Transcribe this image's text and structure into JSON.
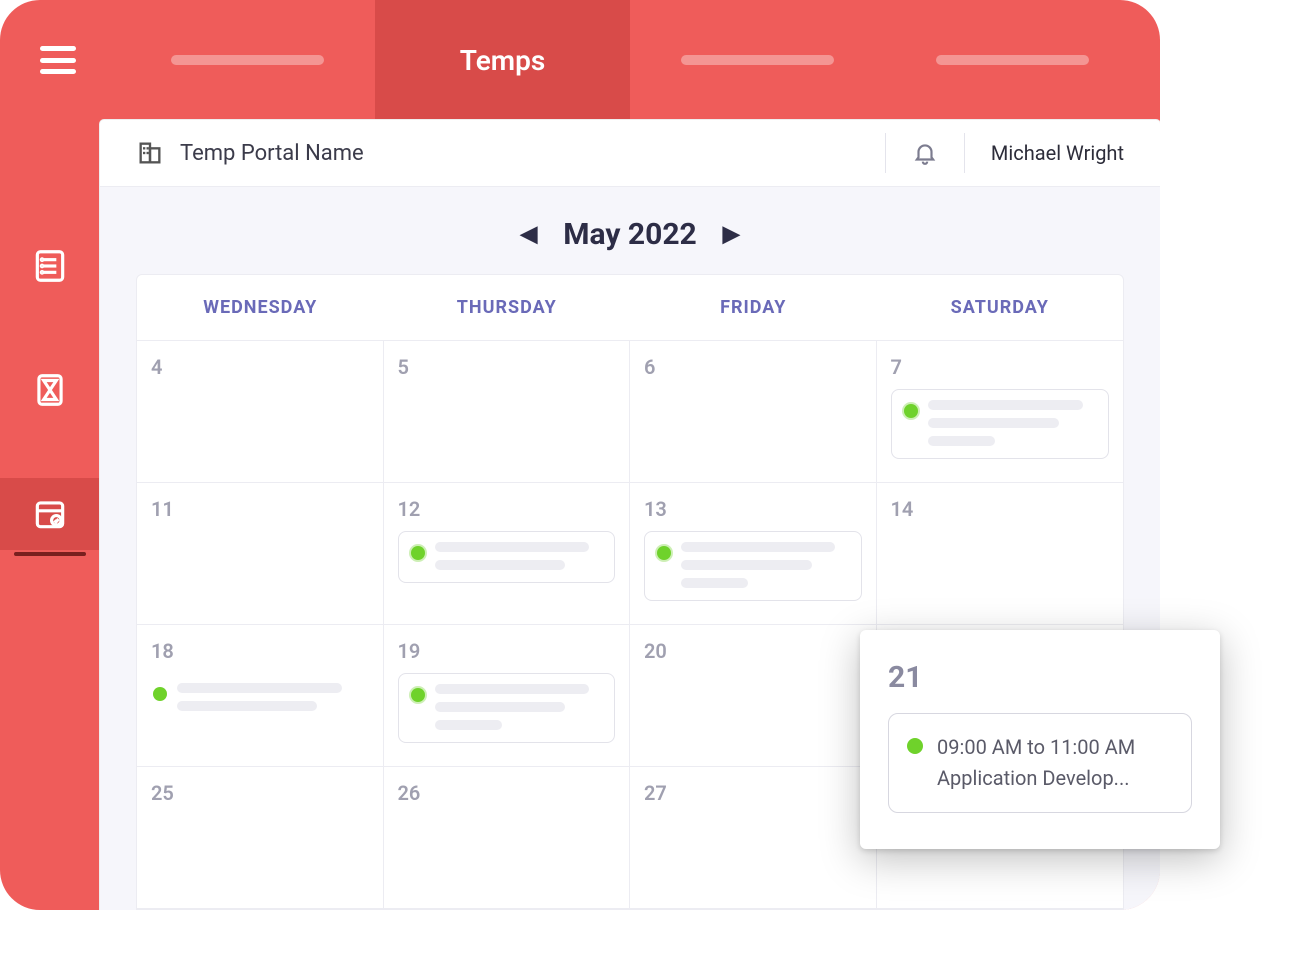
{
  "header": {
    "active_tab_label": "Temps"
  },
  "portal": {
    "name": "Temp Portal Name",
    "user": "Michael Wright"
  },
  "calendar": {
    "month_label": "May 2022",
    "days_of_week": [
      "WEDNESDAY",
      "THURSDAY",
      "FRIDAY",
      "SATURDAY"
    ],
    "weeks": [
      [
        {
          "n": "4"
        },
        {
          "n": "5"
        },
        {
          "n": "6"
        },
        {
          "n": "7",
          "event": {
            "lines": 3,
            "ring": true
          }
        }
      ],
      [
        {
          "n": "11"
        },
        {
          "n": "12",
          "event": {
            "lines": 2,
            "ring": true
          }
        },
        {
          "n": "13",
          "event": {
            "lines": 3,
            "ring": true
          }
        },
        {
          "n": "14"
        }
      ],
      [
        {
          "n": "18",
          "event": {
            "lines": 2,
            "ring": false,
            "noborder": true
          }
        },
        {
          "n": "19",
          "event": {
            "lines": 3,
            "ring": true
          }
        },
        {
          "n": "20"
        },
        {
          "n": ""
        }
      ],
      [
        {
          "n": "25"
        },
        {
          "n": "26"
        },
        {
          "n": "27"
        },
        {
          "n": ""
        }
      ]
    ]
  },
  "popout": {
    "day": "21",
    "time": "09:00 AM to 11:00 AM",
    "title": "Application Develop..."
  }
}
